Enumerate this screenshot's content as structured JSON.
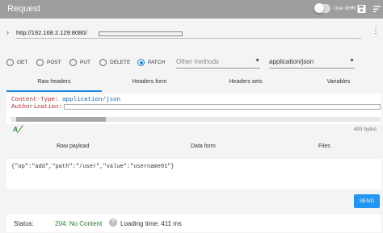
{
  "toolbar": {
    "title": "Request",
    "xhr_label": "Use XHR",
    "save_icon": "save-icon",
    "menu_icon": "sort-menu-icon"
  },
  "url": {
    "value": "http://192.168.2.129:8080/",
    "more_icon": "more-vert-icon",
    "expand_icon": "chevron-right-icon"
  },
  "methods": {
    "options": [
      "GET",
      "POST",
      "PUT",
      "DELETE",
      "PATCH"
    ],
    "selected": "PATCH",
    "other_placeholder": "Other methods",
    "content_type": "application/json"
  },
  "header_tabs": [
    "Raw headers",
    "Headers form",
    "Headers sets",
    "Variables"
  ],
  "headers": {
    "line1_key": "Content-Type:",
    "line1_value": "application/json",
    "line2_key": "Authorization:",
    "size": "493 bytes"
  },
  "payload_tabs": [
    "Raw payload",
    "Data form",
    "Files"
  ],
  "payload": {
    "text": "{\"op\":\"add\",\"path\":\"/user\",\"value\":\"username01\"}"
  },
  "send_label": "SEND",
  "status": {
    "label": "Status:",
    "code": "204: No Content",
    "loading": "Loading time: 411 ms"
  },
  "colors": {
    "accent": "#2196f3",
    "toolbar": "#9e9e9e",
    "success": "#2e7d32"
  }
}
